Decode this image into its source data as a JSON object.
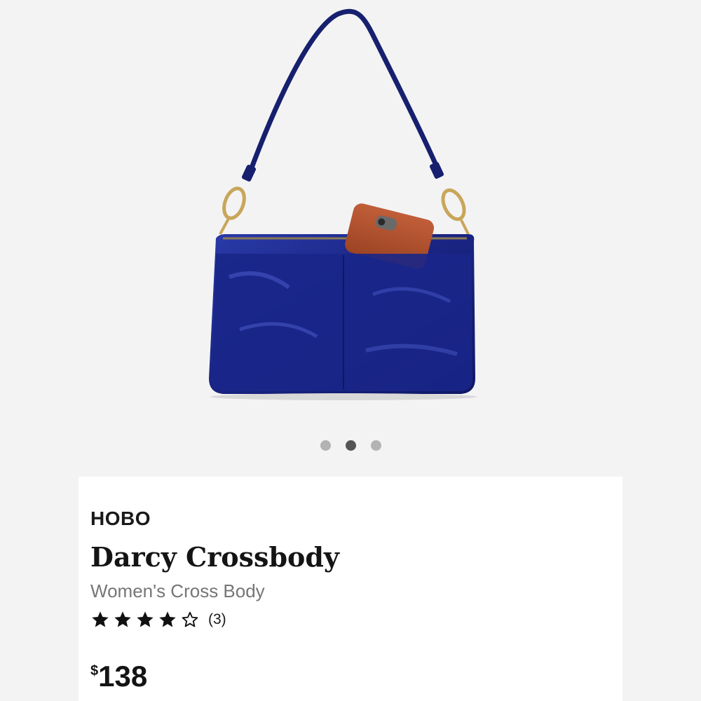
{
  "product": {
    "brand": "HOBO",
    "name": "Darcy Crossbody",
    "category": "Women's Cross Body",
    "rating": 4,
    "rating_max": 5,
    "review_count": "(3)",
    "price_symbol": "$",
    "price_amount": "138"
  },
  "gallery": {
    "image_count": 3,
    "active_index": 1
  },
  "colors": {
    "bag": "#1c2a8c",
    "phone": "#b5502e",
    "hardware": "#c8a65a"
  },
  "icons": {
    "star_filled": "star-filled-icon",
    "star_empty": "star-empty-icon"
  }
}
